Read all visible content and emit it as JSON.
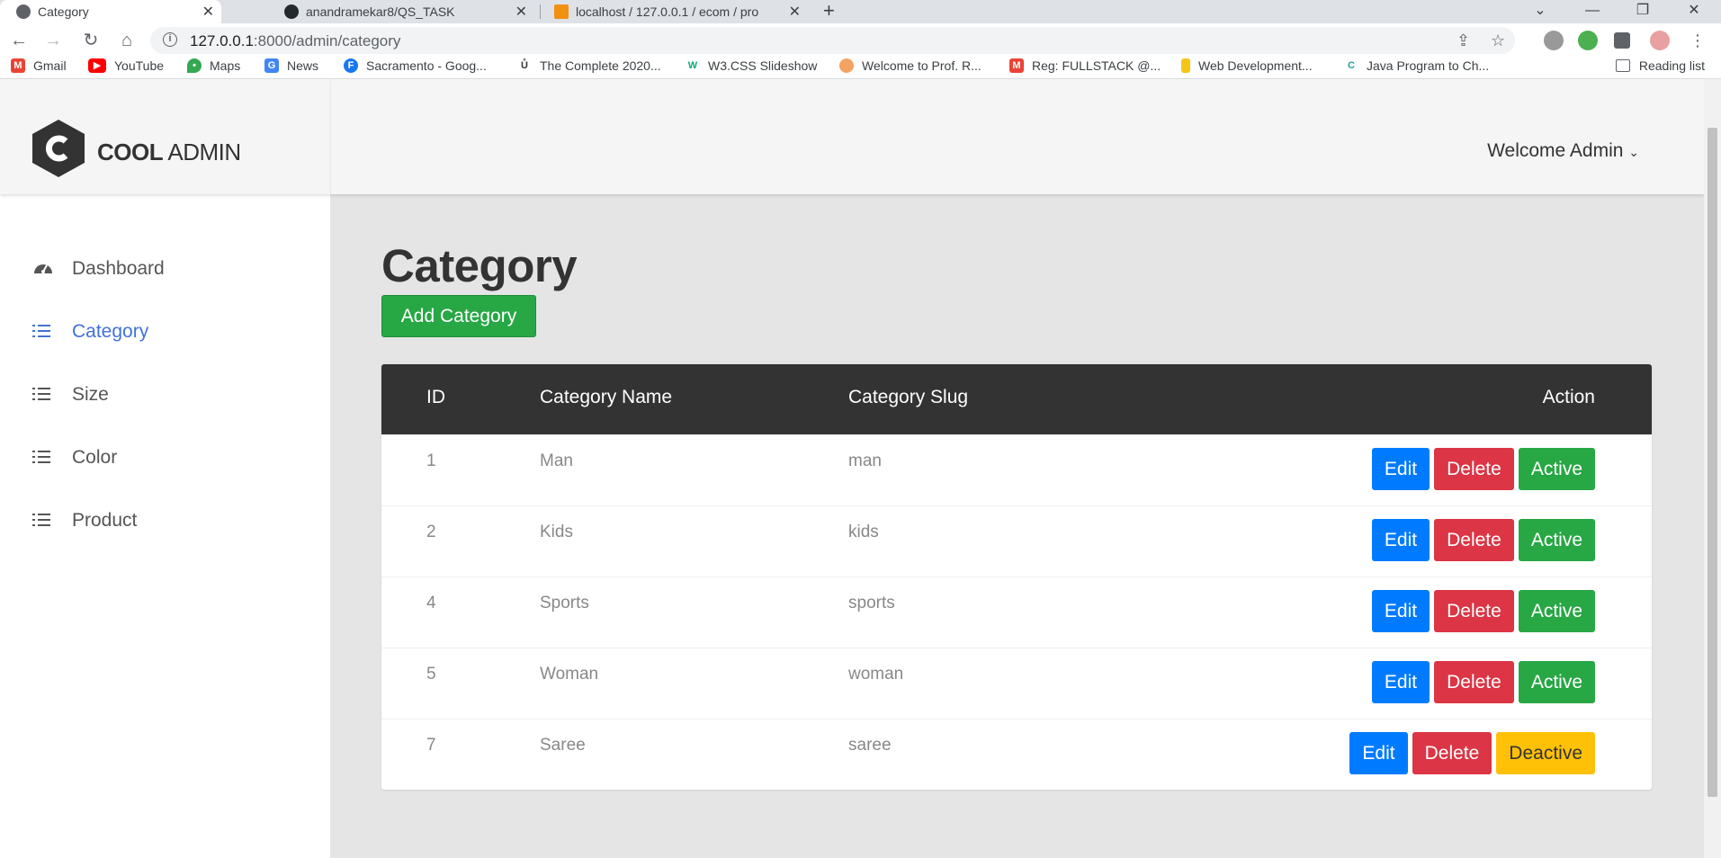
{
  "browser": {
    "tabs": [
      {
        "title": "Category",
        "active": true,
        "icon": "globe-icon"
      },
      {
        "title": "anandramekar8/QS_TASK",
        "active": false,
        "icon": "github-icon"
      },
      {
        "title": "localhost / 127.0.0.1 / ecom / pro",
        "active": false,
        "icon": "phpmyadmin-icon"
      }
    ],
    "url_host": "127.0.0.1",
    "url_rest": ":8000/admin/category",
    "bookmarks": [
      {
        "label": "Gmail",
        "icon": "gmail-icon",
        "color": "#ea4335"
      },
      {
        "label": "YouTube",
        "icon": "youtube-icon",
        "color": "#ff0000"
      },
      {
        "label": "Maps",
        "icon": "maps-icon",
        "color": "#34a853"
      },
      {
        "label": "News",
        "icon": "news-icon",
        "color": "#4285f4"
      },
      {
        "label": "Sacramento - Goog...",
        "icon": "facebook-icon",
        "color": "#1877f2"
      },
      {
        "label": "The Complete 2020...",
        "icon": "udemy-icon",
        "color": "#333333"
      },
      {
        "label": "W3.CSS Slideshow",
        "icon": "w3schools-icon",
        "color": "#04aa6d"
      },
      {
        "label": "Welcome to Prof. R...",
        "icon": "profile-icon",
        "color": "#f4a261"
      },
      {
        "label": "Reg: FULLSTACK @...",
        "icon": "gmail-icon",
        "color": "#ea4335"
      },
      {
        "label": "Web Development...",
        "icon": "bookmark-icon",
        "color": "#f5c518"
      },
      {
        "label": "Java Program to Ch...",
        "icon": "c-icon",
        "color": "#20a39e"
      }
    ],
    "reading_list": "Reading list"
  },
  "app": {
    "logo_bold": "COOL",
    "logo_light": " ADMIN",
    "welcome": "Welcome Admin",
    "menu": [
      {
        "label": "Dashboard",
        "icon": "dashboard-icon",
        "active": false
      },
      {
        "label": "Category",
        "icon": "list-icon",
        "active": true
      },
      {
        "label": "Size",
        "icon": "list-icon",
        "active": false
      },
      {
        "label": "Color",
        "icon": "list-icon",
        "active": false
      },
      {
        "label": "Product",
        "icon": "list-icon",
        "active": false
      }
    ],
    "page_title": "Category",
    "add_button": "Add Category",
    "table": {
      "headers": [
        "ID",
        "Category Name",
        "Category Slug",
        "Action"
      ],
      "rows": [
        {
          "id": "1",
          "name": "Man",
          "slug": "man",
          "status": "Active"
        },
        {
          "id": "2",
          "name": "Kids",
          "slug": "kids",
          "status": "Active"
        },
        {
          "id": "4",
          "name": "Sports",
          "slug": "sports",
          "status": "Active"
        },
        {
          "id": "5",
          "name": "Woman",
          "slug": "woman",
          "status": "Active"
        },
        {
          "id": "7",
          "name": "Saree",
          "slug": "saree",
          "status": "Deactive"
        }
      ],
      "edit_label": "Edit",
      "delete_label": "Delete"
    },
    "colors": {
      "accent": "#4272d7",
      "edit": "#007bff",
      "delete": "#dc3545",
      "active": "#28a745",
      "deactive": "#ffc107"
    }
  }
}
